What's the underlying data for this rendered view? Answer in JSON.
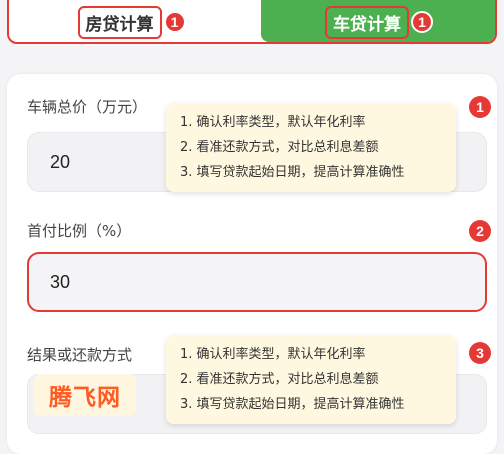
{
  "tabs": {
    "house": {
      "label": "房贷计算",
      "badge": "1"
    },
    "car": {
      "label": "车贷计算",
      "badge": "1"
    }
  },
  "fields": [
    {
      "label": "车辆总价（万元）",
      "value": "20",
      "badge": "1"
    },
    {
      "label": "首付比例（%）",
      "value": "30",
      "badge": "2"
    },
    {
      "label": "结果或还款方式",
      "value": "",
      "badge": "3"
    }
  ],
  "tips": [
    "1. 确认利率类型，默认年化利率",
    "2. 看准还款方式，对比总利息差额",
    "3. 填写贷款起始日期，提高计算准确性"
  ],
  "watermark": "腾飞网",
  "colors": {
    "accent_red": "#e53935",
    "active_tab_green": "#4caf50",
    "tip_background": "#fff8de",
    "logo_orange": "#ff5a1f"
  }
}
